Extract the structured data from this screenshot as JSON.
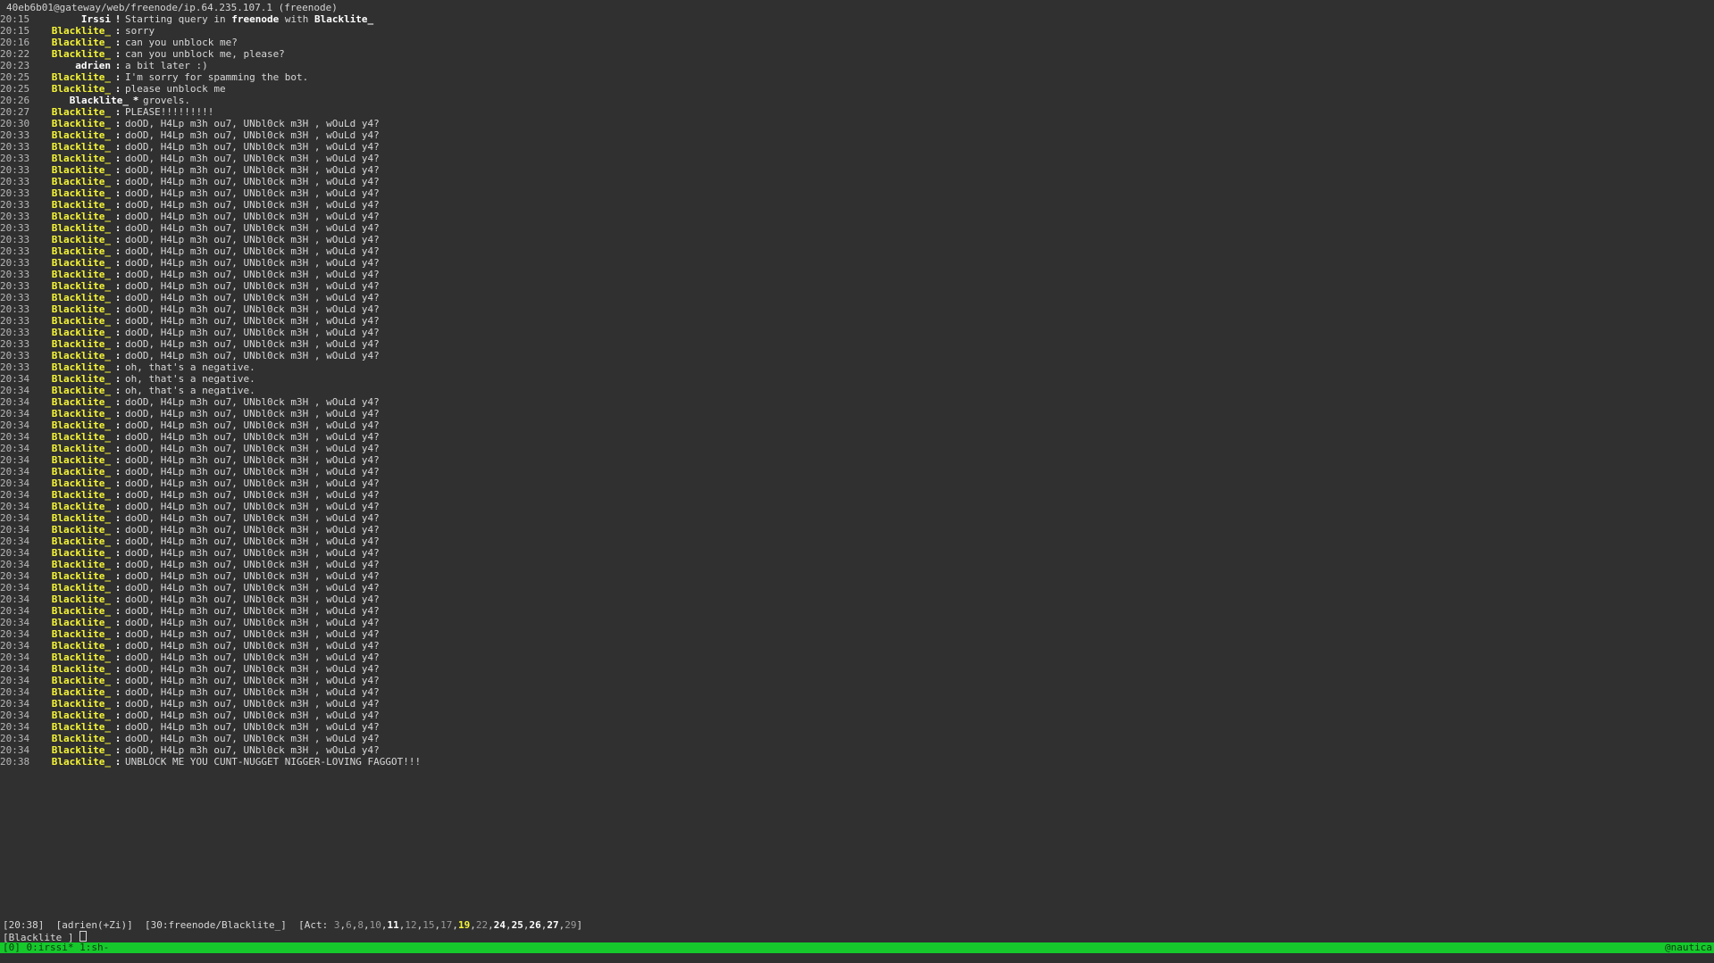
{
  "window": {
    "topic": "40eb6b01@gateway/web/freenode/ip.64.235.107.1 (freenode)"
  },
  "messages": [
    {
      "type": "system",
      "time": "20:15",
      "nick": "Irssi",
      "sep": "!",
      "parts": [
        {
          "t": "Starting query in "
        },
        {
          "t": "freenode",
          "b": true
        },
        {
          "t": " with "
        },
        {
          "t": "Blacklite_",
          "b": true
        }
      ]
    },
    {
      "type": "msg",
      "time": "20:15",
      "nick": "Blacklite_",
      "text": "sorry"
    },
    {
      "type": "msg",
      "time": "20:16",
      "nick": "Blacklite_",
      "text": "can you unblock me?"
    },
    {
      "type": "msg",
      "time": "20:22",
      "nick": "Blacklite_",
      "text": "can you unblock me, please?"
    },
    {
      "type": "msg",
      "time": "20:23",
      "nick": "adrien",
      "self": true,
      "text": "a bit later :)"
    },
    {
      "type": "msg",
      "time": "20:25",
      "nick": "Blacklite_",
      "text": "I'm sorry for spamming the bot."
    },
    {
      "type": "msg",
      "time": "20:25",
      "nick": "Blacklite_",
      "text": "please unblock me"
    },
    {
      "type": "action",
      "time": "20:26",
      "nick": "Blacklite_",
      "sep": "*",
      "text": "grovels."
    },
    {
      "type": "msg",
      "time": "20:27",
      "nick": "Blacklite_",
      "text": "PLEASE!!!!!!!!!"
    },
    {
      "type": "msg",
      "time": "20:30",
      "nick": "Blacklite_",
      "text": "doOD, H4Lp m3h ou7, UNbl0ck m3H , wOuLd y4?"
    },
    {
      "type": "msg",
      "time": "20:33",
      "nick": "Blacklite_",
      "text": "doOD, H4Lp m3h ou7, UNbl0ck m3H , wOuLd y4?"
    },
    {
      "type": "msg",
      "time": "20:33",
      "nick": "Blacklite_",
      "text": "doOD, H4Lp m3h ou7, UNbl0ck m3H , wOuLd y4?"
    },
    {
      "type": "msg",
      "time": "20:33",
      "nick": "Blacklite_",
      "text": "doOD, H4Lp m3h ou7, UNbl0ck m3H , wOuLd y4?"
    },
    {
      "type": "msg",
      "time": "20:33",
      "nick": "Blacklite_",
      "text": "doOD, H4Lp m3h ou7, UNbl0ck m3H , wOuLd y4?"
    },
    {
      "type": "msg",
      "time": "20:33",
      "nick": "Blacklite_",
      "text": "doOD, H4Lp m3h ou7, UNbl0ck m3H , wOuLd y4?"
    },
    {
      "type": "msg",
      "time": "20:33",
      "nick": "Blacklite_",
      "text": "doOD, H4Lp m3h ou7, UNbl0ck m3H , wOuLd y4?"
    },
    {
      "type": "msg",
      "time": "20:33",
      "nick": "Blacklite_",
      "text": "doOD, H4Lp m3h ou7, UNbl0ck m3H , wOuLd y4?"
    },
    {
      "type": "msg",
      "time": "20:33",
      "nick": "Blacklite_",
      "text": "doOD, H4Lp m3h ou7, UNbl0ck m3H , wOuLd y4?"
    },
    {
      "type": "msg",
      "time": "20:33",
      "nick": "Blacklite_",
      "text": "doOD, H4Lp m3h ou7, UNbl0ck m3H , wOuLd y4?"
    },
    {
      "type": "msg",
      "time": "20:33",
      "nick": "Blacklite_",
      "text": "doOD, H4Lp m3h ou7, UNbl0ck m3H , wOuLd y4?"
    },
    {
      "type": "msg",
      "time": "20:33",
      "nick": "Blacklite_",
      "text": "doOD, H4Lp m3h ou7, UNbl0ck m3H , wOuLd y4?"
    },
    {
      "type": "msg",
      "time": "20:33",
      "nick": "Blacklite_",
      "text": "doOD, H4Lp m3h ou7, UNbl0ck m3H , wOuLd y4?"
    },
    {
      "type": "msg",
      "time": "20:33",
      "nick": "Blacklite_",
      "text": "doOD, H4Lp m3h ou7, UNbl0ck m3H , wOuLd y4?"
    },
    {
      "type": "msg",
      "time": "20:33",
      "nick": "Blacklite_",
      "text": "doOD, H4Lp m3h ou7, UNbl0ck m3H , wOuLd y4?"
    },
    {
      "type": "msg",
      "time": "20:33",
      "nick": "Blacklite_",
      "text": "doOD, H4Lp m3h ou7, UNbl0ck m3H , wOuLd y4?"
    },
    {
      "type": "msg",
      "time": "20:33",
      "nick": "Blacklite_",
      "text": "doOD, H4Lp m3h ou7, UNbl0ck m3H , wOuLd y4?"
    },
    {
      "type": "msg",
      "time": "20:33",
      "nick": "Blacklite_",
      "text": "doOD, H4Lp m3h ou7, UNbl0ck m3H , wOuLd y4?"
    },
    {
      "type": "msg",
      "time": "20:33",
      "nick": "Blacklite_",
      "text": "doOD, H4Lp m3h ou7, UNbl0ck m3H , wOuLd y4?"
    },
    {
      "type": "msg",
      "time": "20:33",
      "nick": "Blacklite_",
      "text": "doOD, H4Lp m3h ou7, UNbl0ck m3H , wOuLd y4?"
    },
    {
      "type": "msg",
      "time": "20:33",
      "nick": "Blacklite_",
      "text": "doOD, H4Lp m3h ou7, UNbl0ck m3H , wOuLd y4?"
    },
    {
      "type": "msg",
      "time": "20:33",
      "nick": "Blacklite_",
      "text": "oh, that's a negative."
    },
    {
      "type": "msg",
      "time": "20:34",
      "nick": "Blacklite_",
      "text": "oh, that's a negative."
    },
    {
      "type": "msg",
      "time": "20:34",
      "nick": "Blacklite_",
      "text": "oh, that's a negative."
    },
    {
      "type": "msg",
      "time": "20:34",
      "nick": "Blacklite_",
      "text": "doOD, H4Lp m3h ou7, UNbl0ck m3H , wOuLd y4?"
    },
    {
      "type": "msg",
      "time": "20:34",
      "nick": "Blacklite_",
      "text": "doOD, H4Lp m3h ou7, UNbl0ck m3H , wOuLd y4?"
    },
    {
      "type": "msg",
      "time": "20:34",
      "nick": "Blacklite_",
      "text": "doOD, H4Lp m3h ou7, UNbl0ck m3H , wOuLd y4?"
    },
    {
      "type": "msg",
      "time": "20:34",
      "nick": "Blacklite_",
      "text": "doOD, H4Lp m3h ou7, UNbl0ck m3H , wOuLd y4?"
    },
    {
      "type": "msg",
      "time": "20:34",
      "nick": "Blacklite_",
      "text": "doOD, H4Lp m3h ou7, UNbl0ck m3H , wOuLd y4?"
    },
    {
      "type": "msg",
      "time": "20:34",
      "nick": "Blacklite_",
      "text": "doOD, H4Lp m3h ou7, UNbl0ck m3H , wOuLd y4?"
    },
    {
      "type": "msg",
      "time": "20:34",
      "nick": "Blacklite_",
      "text": "doOD, H4Lp m3h ou7, UNbl0ck m3H , wOuLd y4?"
    },
    {
      "type": "msg",
      "time": "20:34",
      "nick": "Blacklite_",
      "text": "doOD, H4Lp m3h ou7, UNbl0ck m3H , wOuLd y4?"
    },
    {
      "type": "msg",
      "time": "20:34",
      "nick": "Blacklite_",
      "text": "doOD, H4Lp m3h ou7, UNbl0ck m3H , wOuLd y4?"
    },
    {
      "type": "msg",
      "time": "20:34",
      "nick": "Blacklite_",
      "text": "doOD, H4Lp m3h ou7, UNbl0ck m3H , wOuLd y4?"
    },
    {
      "type": "msg",
      "time": "20:34",
      "nick": "Blacklite_",
      "text": "doOD, H4Lp m3h ou7, UNbl0ck m3H , wOuLd y4?"
    },
    {
      "type": "msg",
      "time": "20:34",
      "nick": "Blacklite_",
      "text": "doOD, H4Lp m3h ou7, UNbl0ck m3H , wOuLd y4?"
    },
    {
      "type": "msg",
      "time": "20:34",
      "nick": "Blacklite_",
      "text": "doOD, H4Lp m3h ou7, UNbl0ck m3H , wOuLd y4?"
    },
    {
      "type": "msg",
      "time": "20:34",
      "nick": "Blacklite_",
      "text": "doOD, H4Lp m3h ou7, UNbl0ck m3H , wOuLd y4?"
    },
    {
      "type": "msg",
      "time": "20:34",
      "nick": "Blacklite_",
      "text": "doOD, H4Lp m3h ou7, UNbl0ck m3H , wOuLd y4?"
    },
    {
      "type": "msg",
      "time": "20:34",
      "nick": "Blacklite_",
      "text": "doOD, H4Lp m3h ou7, UNbl0ck m3H , wOuLd y4?"
    },
    {
      "type": "msg",
      "time": "20:34",
      "nick": "Blacklite_",
      "text": "doOD, H4Lp m3h ou7, UNbl0ck m3H , wOuLd y4?"
    },
    {
      "type": "msg",
      "time": "20:34",
      "nick": "Blacklite_",
      "text": "doOD, H4Lp m3h ou7, UNbl0ck m3H , wOuLd y4?"
    },
    {
      "type": "msg",
      "time": "20:34",
      "nick": "Blacklite_",
      "text": "doOD, H4Lp m3h ou7, UNbl0ck m3H , wOuLd y4?"
    },
    {
      "type": "msg",
      "time": "20:34",
      "nick": "Blacklite_",
      "text": "doOD, H4Lp m3h ou7, UNbl0ck m3H , wOuLd y4?"
    },
    {
      "type": "msg",
      "time": "20:34",
      "nick": "Blacklite_",
      "text": "doOD, H4Lp m3h ou7, UNbl0ck m3H , wOuLd y4?"
    },
    {
      "type": "msg",
      "time": "20:34",
      "nick": "Blacklite_",
      "text": "doOD, H4Lp m3h ou7, UNbl0ck m3H , wOuLd y4?"
    },
    {
      "type": "msg",
      "time": "20:34",
      "nick": "Blacklite_",
      "text": "doOD, H4Lp m3h ou7, UNbl0ck m3H , wOuLd y4?"
    },
    {
      "type": "msg",
      "time": "20:34",
      "nick": "Blacklite_",
      "text": "doOD, H4Lp m3h ou7, UNbl0ck m3H , wOuLd y4?"
    },
    {
      "type": "msg",
      "time": "20:34",
      "nick": "Blacklite_",
      "text": "doOD, H4Lp m3h ou7, UNbl0ck m3H , wOuLd y4?"
    },
    {
      "type": "msg",
      "time": "20:34",
      "nick": "Blacklite_",
      "text": "doOD, H4Lp m3h ou7, UNbl0ck m3H , wOuLd y4?"
    },
    {
      "type": "msg",
      "time": "20:34",
      "nick": "Blacklite_",
      "text": "doOD, H4Lp m3h ou7, UNbl0ck m3H , wOuLd y4?"
    },
    {
      "type": "msg",
      "time": "20:34",
      "nick": "Blacklite_",
      "text": "doOD, H4Lp m3h ou7, UNbl0ck m3H , wOuLd y4?"
    },
    {
      "type": "msg",
      "time": "20:34",
      "nick": "Blacklite_",
      "text": "doOD, H4Lp m3h ou7, UNbl0ck m3H , wOuLd y4?"
    },
    {
      "type": "msg",
      "time": "20:34",
      "nick": "Blacklite_",
      "text": "doOD, H4Lp m3h ou7, UNbl0ck m3H , wOuLd y4?"
    },
    {
      "type": "msg",
      "time": "20:34",
      "nick": "Blacklite_",
      "text": "doOD, H4Lp m3h ou7, UNbl0ck m3H , wOuLd y4?"
    },
    {
      "type": "msg",
      "time": "20:38",
      "nick": "Blacklite_",
      "text": "UNBLOCK ME YOU CUNT-NUGGET NIGGER-LOVING FAGGOT!!!"
    }
  ],
  "statusbar": {
    "clock": "[20:38]",
    "user": "[adrien(+Zi)]",
    "window": "[30:freenode/Blacklite_]",
    "act_prefix": "[Act: ",
    "act_suffix": "]",
    "act": [
      {
        "n": "3",
        "s": "dim"
      },
      {
        "n": "6",
        "s": "dim"
      },
      {
        "n": "8",
        "s": "dim"
      },
      {
        "n": "10",
        "s": "dim"
      },
      {
        "n": "11",
        "s": "hi"
      },
      {
        "n": "12",
        "s": "dim"
      },
      {
        "n": "15",
        "s": "dim"
      },
      {
        "n": "17",
        "s": "dim"
      },
      {
        "n": "19",
        "s": "hl"
      },
      {
        "n": "22",
        "s": "dim"
      },
      {
        "n": "24",
        "s": "hi"
      },
      {
        "n": "25",
        "s": "hi"
      },
      {
        "n": "26",
        "s": "hi"
      },
      {
        "n": "27",
        "s": "hi"
      },
      {
        "n": "29",
        "s": "dim"
      }
    ]
  },
  "input": {
    "prompt": "[Blacklite_] "
  },
  "tmux": {
    "left": "[0] 0:irssi* 1:sh-",
    "right": "@nautica"
  },
  "colors": {
    "background": "#303030",
    "nick": "#f5f536",
    "tmux_bar": "#16c82c"
  }
}
